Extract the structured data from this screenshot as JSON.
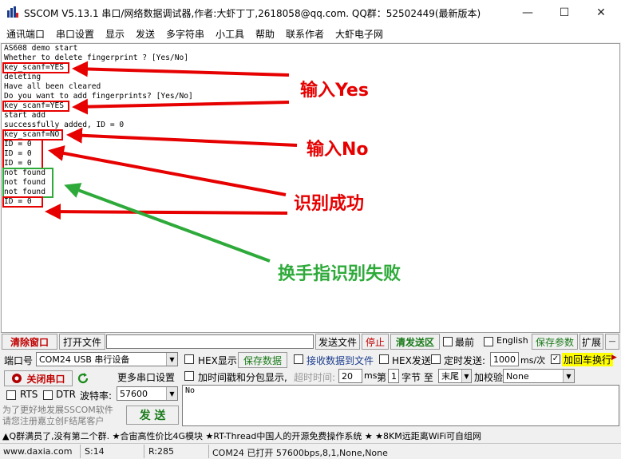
{
  "window": {
    "title": "SSCOM V5.13.1 串口/网络数据调试器,作者:大虾丁丁,2618058@qq.com. QQ群：52502449(最新版本)",
    "minimize_symbol": "—",
    "maximize_symbol": "☐",
    "close_symbol": "✕"
  },
  "menu": [
    "通讯端口",
    "串口设置",
    "显示",
    "发送",
    "多字符串",
    "小工具",
    "帮助",
    "联系作者",
    "大虾电子网"
  ],
  "receive": {
    "lines": [
      "AS608 demo start",
      "Whether to delete fingerprint ?  [Yes/No]",
      "key_scanf=YES",
      "deleting",
      "Have all been cleared",
      "Do you want to add fingerprints? [Yes/No]",
      "key_scanf=YES",
      "start add",
      "successfully added, ID = 0",
      "key_scanf=NO",
      "ID = 0",
      "ID = 0",
      "ID = 0",
      "not found",
      "not found",
      "not found",
      "ID = 0"
    ],
    "annotations": {
      "yes": "输入Yes",
      "no": "输入No",
      "success": "识别成功",
      "fail": "换手指识别失败"
    },
    "annotation_colors": {
      "red": "#e60000",
      "green": "#2eaa3a"
    }
  },
  "toolbar1": {
    "clear_window": "清除窗口",
    "open_file": "打开文件",
    "file_path": "",
    "send_file": "发送文件",
    "stop": "停止",
    "clear_send": "清发送区",
    "topmost": "最前",
    "english": "English",
    "save_params": "保存参数",
    "expand": "扩展",
    "minus": "—"
  },
  "port": {
    "port_label": "端口号",
    "port_value": "COM24 USB 串行设备",
    "hex_display": "HEX显示",
    "save_data": "保存数据",
    "recv_to_file": "接收数据到文件",
    "hex_send": "HEX发送",
    "timed_send": "定时发送:",
    "interval": "1000",
    "interval_unit": "ms/次",
    "append_crlf": "加回车换行",
    "close_port": "关闭串口",
    "more_settings": "更多串口设置",
    "timestamp": "加时间戳和分包显示,",
    "timeout_label": "超时时间:",
    "timeout_value": "20",
    "ms": "ms",
    "nth": "第",
    "byte_index": "1",
    "byte_label": "字节 至",
    "end_value": "末尾",
    "checksum_label": "加校验",
    "checksum_value": "None",
    "rts": "RTS",
    "dtr": "DTR",
    "baud_label": "波特率:",
    "baud_value": "57600",
    "send_text": "No",
    "send_button": "发 送",
    "promo": "为了更好地发展SSCOM软件\n请您注册嘉立创F结尾客户"
  },
  "ticker": "▲Q群满员了,没有第二个群. ★合宙高性价比4G模块 ★RT-Thread中国人的开源免费操作系统 ★ ★8KM远距离WiFi可自组网",
  "status": {
    "url": "www.daxia.com",
    "sent": "S:14",
    "received": "R:285",
    "port_state": "COM24 已打开  57600bps,8,1,None,None"
  }
}
